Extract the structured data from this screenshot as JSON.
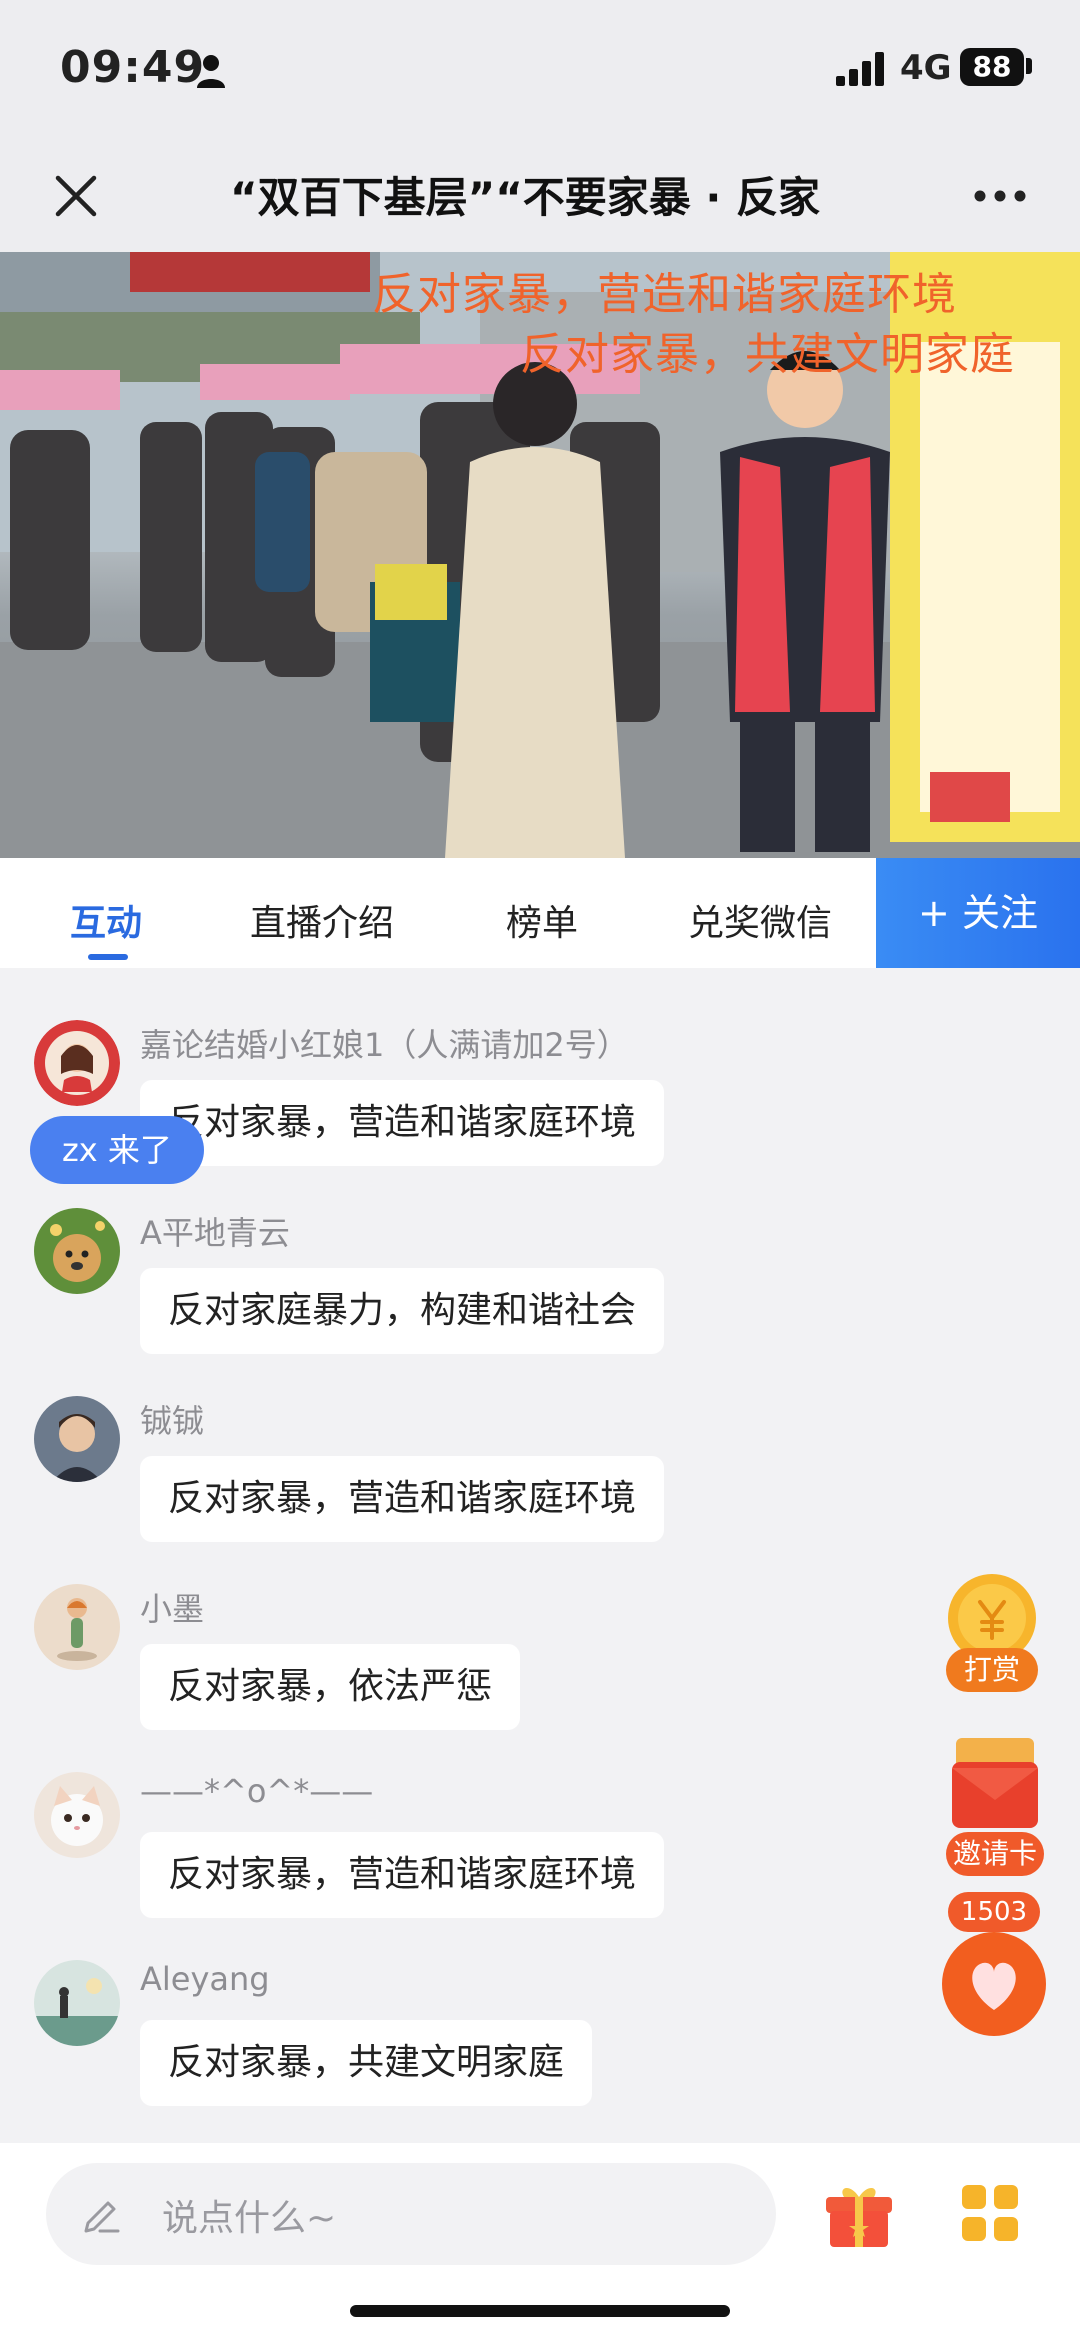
{
  "status_bar": {
    "time": "09:49",
    "network": "4G",
    "battery": "88"
  },
  "nav": {
    "title": "“双百下基层”“不要家暴 · 反家"
  },
  "video": {
    "overlay_line1": "反对家暴，营造和谐家庭环境",
    "overlay_line2": "反对家暴，共建文明家庭"
  },
  "tabs": [
    {
      "label": "互动",
      "active": true
    },
    {
      "label": "直播介绍"
    },
    {
      "label": "榜单"
    },
    {
      "label": "兑奖微信"
    }
  ],
  "follow_label": "+ 关注",
  "messages": [
    {
      "user": "嘉论结婚小红娘1（人满请加2号）",
      "text": "反对家暴，营造和谐家庭环境",
      "avatar": "bride-avatar"
    },
    {
      "user": "A平地青云",
      "text": "反对家庭暴力，构建和谐社会",
      "avatar": "dog-avatar"
    },
    {
      "user": "铖铖",
      "text": "反对家暴，营造和谐家庭环境",
      "avatar": "portrait-avatar"
    },
    {
      "user": "小墨",
      "text": "反对家暴，依法严惩",
      "avatar": "figure-avatar"
    },
    {
      "user": "——*^o^*——",
      "text": "反对家暴，营造和谐家庭环境",
      "avatar": "cat-avatar"
    },
    {
      "user": "Aleyang",
      "text": "反对家暴，共建文明家庭",
      "avatar": "landscape-avatar"
    }
  ],
  "join_toast": "zx 来了",
  "floating": {
    "reward_label": "打赏",
    "invite_label": "邀请卡",
    "like_count": "1503"
  },
  "bottom": {
    "input_placeholder": "说点什么~"
  },
  "colors": {
    "accent": "#2a6ae0",
    "overlay_text": "#f0632b",
    "reward": "#f07a1e"
  }
}
